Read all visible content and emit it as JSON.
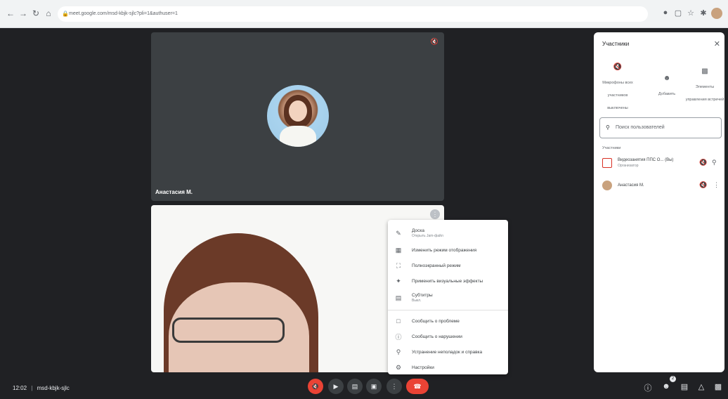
{
  "browser": {
    "url": "meet.google.com/msd-kbjk-sjlc?pli=1&authuser=1"
  },
  "tiles": {
    "top_name": "Анастасия М."
  },
  "menu": {
    "items": [
      {
        "label": "Доска",
        "sub": "Открыть Jam-файл",
        "icon": "pen-icon"
      },
      {
        "label": "Изменить режим отображения",
        "sub": "",
        "icon": "layout-icon"
      },
      {
        "label": "Полноэкранный режим",
        "sub": "",
        "icon": "fullscreen-icon"
      },
      {
        "label": "Применить визуальные эффекты",
        "sub": "",
        "icon": "sparkle-icon"
      },
      {
        "label": "Субтитры",
        "sub": "Выкл.",
        "icon": "captions-icon"
      },
      {
        "label": "Сообщить о проблеме",
        "sub": "",
        "icon": "feedback-icon"
      },
      {
        "label": "Сообщить о нарушении",
        "sub": "",
        "icon": "report-icon"
      },
      {
        "label": "Устранение неполадок и справка",
        "sub": "",
        "icon": "troubleshoot-icon"
      },
      {
        "label": "Настройки",
        "sub": "",
        "icon": "settings-icon"
      }
    ]
  },
  "panel": {
    "title": "Участники",
    "actions": {
      "mute_all": "Микрофоны всех участников выключены",
      "add": "Добавить",
      "host_controls": "Элементы управления встречей"
    },
    "search_placeholder": "Поиск пользователей",
    "section": "Участники",
    "participants": [
      {
        "name": "Видеозанятия ППС О... (Вы)",
        "role": "Организатор"
      },
      {
        "name": "Анастасия М.",
        "role": ""
      }
    ]
  },
  "bottom": {
    "time": "12:02",
    "meeting_code": "msd-kbjk-sjlc",
    "participant_count": "2"
  },
  "colors": {
    "stage": "#202124",
    "tile": "#3c4043",
    "red": "#ea4335"
  }
}
